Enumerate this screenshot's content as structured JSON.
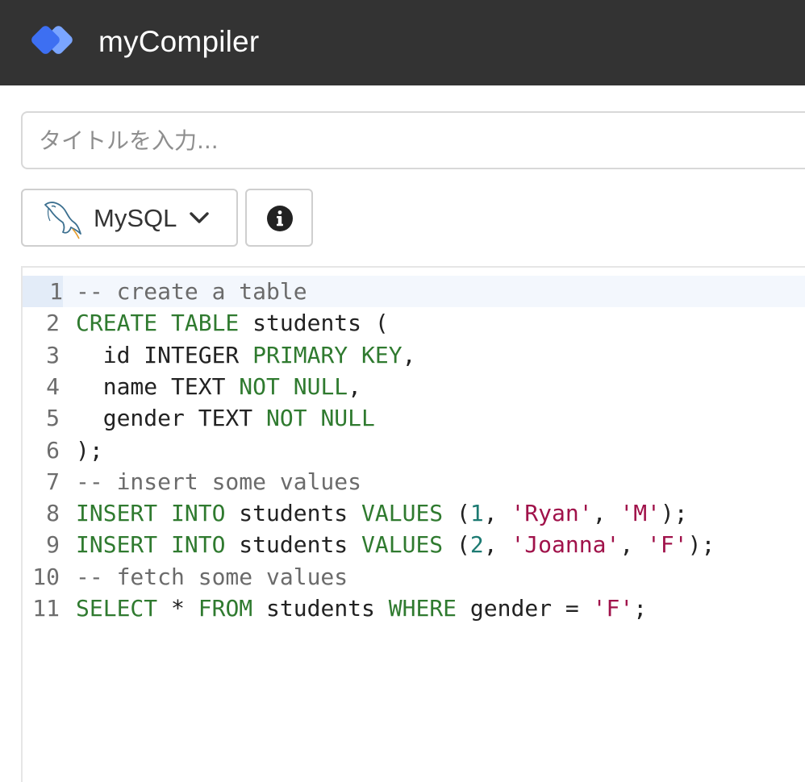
{
  "header": {
    "brand": "myCompiler"
  },
  "title_input": {
    "placeholder": "タイトルを入力..."
  },
  "toolbar": {
    "language_label": "MySQL"
  },
  "colors": {
    "topbar": "#333333",
    "logo_primary": "#3d6ff2",
    "logo_secondary": "#6f9bff",
    "keyword": "#2f7a2f",
    "string": "#a0124a",
    "number": "#1c7a72",
    "comment": "#6b6b6b"
  },
  "icons": {
    "logo": "diamond-logo-icon",
    "language": "mysql-dolphin-icon",
    "dropdown": "chevron-down-icon",
    "info": "info-circle-icon"
  },
  "editor": {
    "active_line": 1,
    "lines": [
      {
        "num": "1",
        "tokens": [
          {
            "t": "comment",
            "v": "-- create a table"
          }
        ]
      },
      {
        "num": "2",
        "tokens": [
          {
            "t": "kw",
            "v": "CREATE TABLE"
          },
          {
            "t": "plain",
            "v": " students ("
          }
        ]
      },
      {
        "num": "3",
        "tokens": [
          {
            "t": "plain",
            "v": "  id INTEGER "
          },
          {
            "t": "kw",
            "v": "PRIMARY KEY"
          },
          {
            "t": "plain",
            "v": ","
          }
        ]
      },
      {
        "num": "4",
        "tokens": [
          {
            "t": "plain",
            "v": "  name TEXT "
          },
          {
            "t": "kw",
            "v": "NOT NULL"
          },
          {
            "t": "plain",
            "v": ","
          }
        ]
      },
      {
        "num": "5",
        "tokens": [
          {
            "t": "plain",
            "v": "  gender TEXT "
          },
          {
            "t": "kw",
            "v": "NOT NULL"
          }
        ]
      },
      {
        "num": "6",
        "tokens": [
          {
            "t": "plain",
            "v": ");"
          }
        ]
      },
      {
        "num": "7",
        "tokens": [
          {
            "t": "comment",
            "v": "-- insert some values"
          }
        ]
      },
      {
        "num": "8",
        "tokens": [
          {
            "t": "kw",
            "v": "INSERT INTO"
          },
          {
            "t": "plain",
            "v": " students "
          },
          {
            "t": "kw",
            "v": "VALUES"
          },
          {
            "t": "plain",
            "v": " ("
          },
          {
            "t": "num",
            "v": "1"
          },
          {
            "t": "plain",
            "v": ", "
          },
          {
            "t": "str",
            "v": "'Ryan'"
          },
          {
            "t": "plain",
            "v": ", "
          },
          {
            "t": "str",
            "v": "'M'"
          },
          {
            "t": "plain",
            "v": ");"
          }
        ]
      },
      {
        "num": "9",
        "tokens": [
          {
            "t": "kw",
            "v": "INSERT INTO"
          },
          {
            "t": "plain",
            "v": " students "
          },
          {
            "t": "kw",
            "v": "VALUES"
          },
          {
            "t": "plain",
            "v": " ("
          },
          {
            "t": "num",
            "v": "2"
          },
          {
            "t": "plain",
            "v": ", "
          },
          {
            "t": "str",
            "v": "'Joanna'"
          },
          {
            "t": "plain",
            "v": ", "
          },
          {
            "t": "str",
            "v": "'F'"
          },
          {
            "t": "plain",
            "v": ");"
          }
        ]
      },
      {
        "num": "10",
        "tokens": [
          {
            "t": "comment",
            "v": "-- fetch some values"
          }
        ]
      },
      {
        "num": "11",
        "tokens": [
          {
            "t": "kw",
            "v": "SELECT"
          },
          {
            "t": "plain",
            "v": " * "
          },
          {
            "t": "kw",
            "v": "FROM"
          },
          {
            "t": "plain",
            "v": " students "
          },
          {
            "t": "kw",
            "v": "WHERE"
          },
          {
            "t": "plain",
            "v": " gender = "
          },
          {
            "t": "str",
            "v": "'F'"
          },
          {
            "t": "plain",
            "v": ";"
          }
        ]
      }
    ]
  }
}
